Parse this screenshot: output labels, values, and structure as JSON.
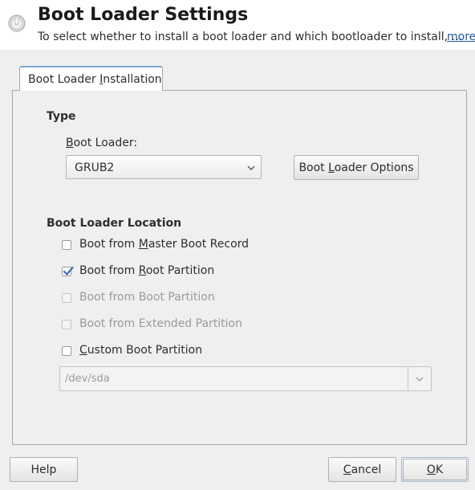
{
  "header": {
    "title": "Boot Loader Settings",
    "subtitle": "To select whether to install a boot loader and which bootloader to install, …",
    "more_link": "more",
    "icon": "power-icon"
  },
  "tabs": [
    {
      "label_pre": "Boot Loader ",
      "label_accel": "I",
      "label_post": "nstallation",
      "active": true
    }
  ],
  "type_section": {
    "heading": "Type",
    "boot_loader_label_accel": "B",
    "boot_loader_label_rest": "oot Loader:",
    "boot_loader_value": "GRUB2",
    "options_button_pre": "Boot ",
    "options_button_accel": "L",
    "options_button_post": "oader Options"
  },
  "location_section": {
    "heading": "Boot Loader Location",
    "options": [
      {
        "pre": "Boot from ",
        "accel": "M",
        "post": "aster Boot Record",
        "checked": false,
        "enabled": true
      },
      {
        "pre": "Boot from ",
        "accel": "R",
        "post": "oot Partition",
        "checked": true,
        "enabled": true
      },
      {
        "pre": "Boot from Boot Partition",
        "accel": "",
        "post": "",
        "checked": false,
        "enabled": false
      },
      {
        "pre": "Boot from Extended Partition",
        "accel": "",
        "post": "",
        "checked": false,
        "enabled": false
      },
      {
        "pre": "",
        "accel": "C",
        "post": "ustom Boot Partition",
        "checked": false,
        "enabled": true
      }
    ],
    "custom_partition_value": "/dev/sda"
  },
  "footer": {
    "help_label": "Help",
    "cancel_accel": "C",
    "cancel_rest": "ancel",
    "ok_accel": "O",
    "ok_rest": "K"
  },
  "colors": {
    "link": "#2156a5",
    "tab_accent": "#7aa6d6",
    "check": "#3b6fb5"
  }
}
